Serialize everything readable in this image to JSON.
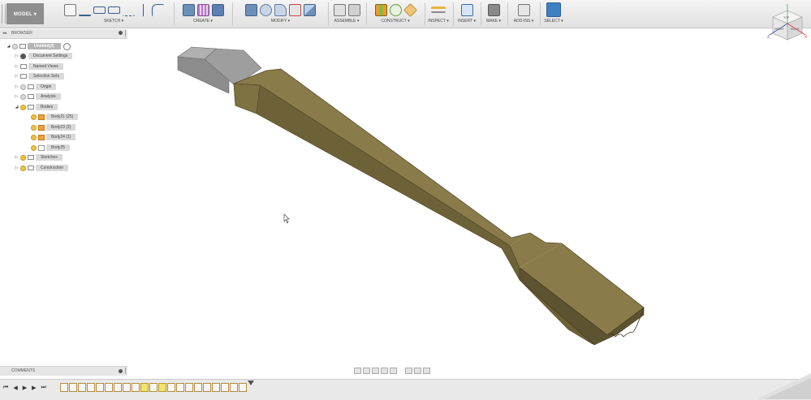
{
  "toolbar": {
    "workspace": "MODEL ▾",
    "groups": [
      {
        "label": "SKETCH ▾"
      },
      {
        "label": "CREATE ▾"
      },
      {
        "label": "MODIFY ▾"
      },
      {
        "label": "ASSEMBLE ▾"
      },
      {
        "label": "CONSTRUCT ▾"
      },
      {
        "label": "INSPECT ▾"
      },
      {
        "label": "INSERT ▾"
      },
      {
        "label": "MAKE ▾"
      },
      {
        "label": "ADD-INS ▾"
      },
      {
        "label": "SELECT ▾"
      }
    ]
  },
  "browser": {
    "title": "BROWSER",
    "collapse_glyph": "◂◂",
    "root": "Untitled(2)",
    "items": [
      {
        "label": "Document Settings"
      },
      {
        "label": "Named Views"
      },
      {
        "label": "Selection Sets"
      },
      {
        "label": "Origin"
      },
      {
        "label": "Analysis"
      },
      {
        "label": "Bodies"
      },
      {
        "label": "Body21 (25)"
      },
      {
        "label": "Body23 (2)"
      },
      {
        "label": "Body24 (1)"
      },
      {
        "label": "Body25"
      },
      {
        "label": "Sketches"
      },
      {
        "label": "Construction"
      }
    ]
  },
  "comments": {
    "title": "COMMENTS"
  },
  "navcube": {
    "top": "TOP",
    "front": "FRONT",
    "right": "RIGHT",
    "axis_y": "Y",
    "axis_x": "X",
    "axis_z": "Z"
  },
  "timeline": {
    "first": "⏮",
    "prev": "◀",
    "play": "▶",
    "next": "▶",
    "last": "⏭"
  },
  "colors": {
    "body": "#8a7c4a",
    "body_side": "#5e5330",
    "block": "#8c8c8c",
    "selected": "#3e7fc1"
  },
  "icons": [
    "sketch-icon",
    "extrude-icon",
    "fillet-icon",
    "joint-icon",
    "plane-icon",
    "measure-icon",
    "insert-icon",
    "3dprint-icon",
    "scripts-icon",
    "select-icon"
  ]
}
